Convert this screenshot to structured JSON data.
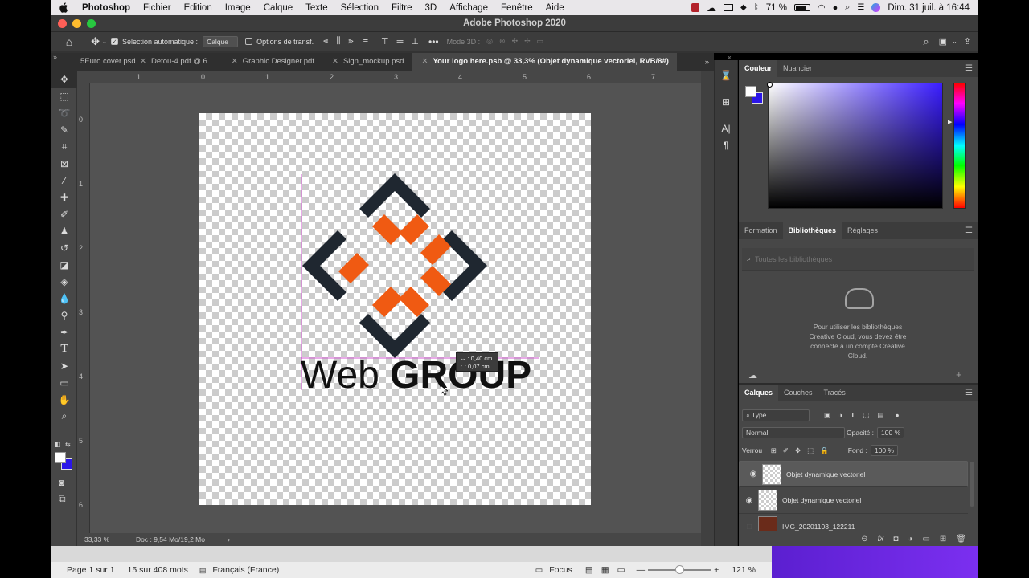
{
  "menubar": {
    "app": "Photoshop",
    "items": [
      "Fichier",
      "Edition",
      "Image",
      "Calque",
      "Texte",
      "Sélection",
      "Filtre",
      "3D",
      "Affichage",
      "Fenêtre",
      "Aide"
    ],
    "battery": "71 %",
    "datetime": "Dim. 31 juil. à  16:44"
  },
  "window": {
    "title": "Adobe Photoshop 2020"
  },
  "options": {
    "auto_select_label": "Sélection automatique :",
    "auto_select_value": "Calque",
    "transform_label": "Options de transf.",
    "mode3d_label": "Mode 3D :"
  },
  "tabs": [
    {
      "label": "5Euro cover.psd ..."
    },
    {
      "label": "Detou-4.pdf @ 6..."
    },
    {
      "label": "Graphic Designer.pdf"
    },
    {
      "label": "Sign_mockup.psd"
    },
    {
      "label": "Your logo here.psb @ 33,3% (Objet dynamique vectoriel, RVB/8#)"
    }
  ],
  "rulers": {
    "h": [
      "1",
      "0",
      "1",
      "2",
      "3",
      "4",
      "5",
      "6",
      "7"
    ],
    "v": [
      "0",
      "1",
      "2",
      "3",
      "4",
      "5",
      "6"
    ]
  },
  "logo": {
    "text_light": "Web",
    "text_bold": "GROUP",
    "dark_color": "#1f2730",
    "accent_color": "#f05a12"
  },
  "tooltip": {
    "line1": "↔ : 0,40 cm",
    "line2": "↕ : 0,07 cm"
  },
  "status": {
    "zoom": "33,33 %",
    "doc": "Doc : 9,54 Mo/19,2 Mo"
  },
  "color_panel": {
    "tabs": [
      "Couleur",
      "Nuancier"
    ],
    "fg_color": "#ffffff",
    "bg_color": "#2b16e8",
    "hue_color": "#3a1dff"
  },
  "libraries_panel": {
    "tabs": [
      "Formation",
      "Bibliothèques",
      "Réglages"
    ],
    "search_placeholder": "Toutes les bibliothèques",
    "message": "Pour utiliser les bibliothèques Creative Cloud, vous devez être connecté à un compte Creative Cloud."
  },
  "layers_panel": {
    "tabs": [
      "Calques",
      "Couches",
      "Tracés"
    ],
    "filter": "Type",
    "blend_mode": "Normal",
    "opacity_label": "Opacité :",
    "opacity_value": "100 %",
    "lock_label": "Verrou :",
    "fill_label": "Fond :",
    "fill_value": "100 %",
    "layers": [
      {
        "name": "Objet dynamique vectoriel",
        "selected": true
      },
      {
        "name": "Objet dynamique vectoriel",
        "selected": false
      },
      {
        "name": "IMG_20201103_122211",
        "selected": false
      }
    ]
  },
  "word_status": {
    "page": "Page 1 sur 1",
    "words": "15 sur 408 mots",
    "language": "Français (France)",
    "focus": "Focus",
    "zoom": "121 %"
  }
}
